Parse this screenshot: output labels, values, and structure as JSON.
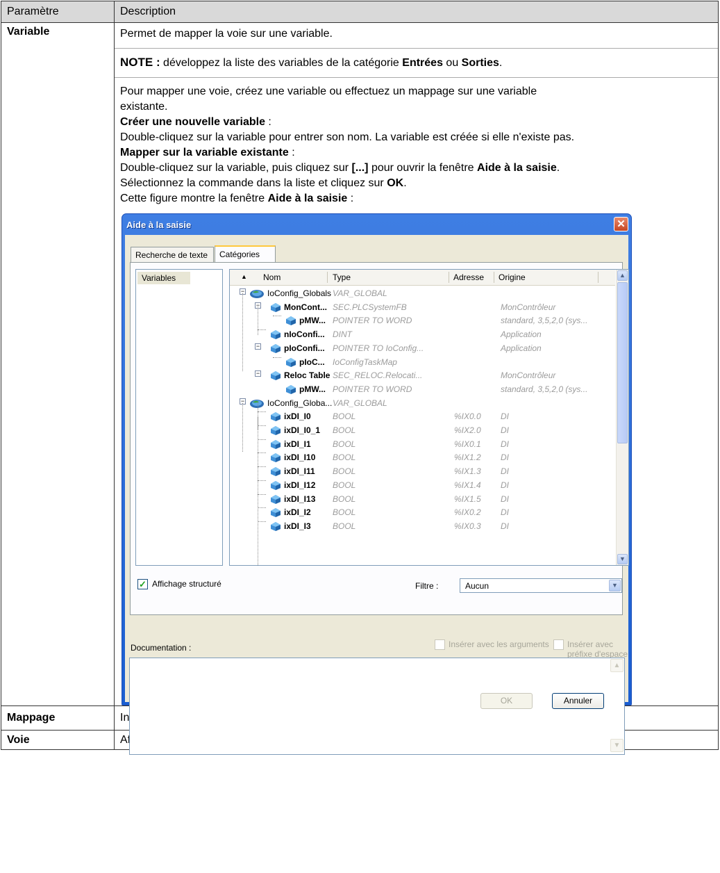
{
  "table": {
    "header": {
      "param": "Paramètre",
      "desc": "Description"
    },
    "variable": {
      "name": "Variable",
      "p1": "Permet de mapper la voie sur une variable.",
      "note_label": "NOTE :",
      "note_text_a": " développez la liste des variables de la catégorie ",
      "note_entrees": "Entrées",
      "note_or": " ou ",
      "note_sorties": "Sorties",
      "note_end": ".",
      "p3_line1": "Pour mapper une voie, créez une variable ou effectuez un mappage sur une variable",
      "p3_line2": "existante.",
      "create_title": "Créer une nouvelle variable",
      "create_colon": " :",
      "create_text": "Double-cliquez sur la variable pour entrer son nom. La variable est créée si elle n'existe pas.",
      "map_title": "Mapper sur la variable existante",
      "map_colon": " :",
      "map_text_a": "Double-cliquez sur la variable, puis cliquez sur ",
      "map_dots": "[...]",
      "map_text_b": " pour ouvrir la fenêtre ",
      "map_aide": "Aide à la saisie",
      "map_end": ".",
      "select_a": "Sélectionnez la commande dans la liste et cliquez sur ",
      "select_ok": "OK",
      "select_end": ".",
      "fig_a": "Cette figure montre la fenêtre ",
      "fig_aide": "Aide à la saisie",
      "fig_end": " :"
    },
    "mappage": {
      "name": "Mappage",
      "desc": "Indique si la voie est mappée sur une variable nouvelle ou existante."
    },
    "voie": {
      "name": "Voie",
      "desc": "Affiche le nom de la voie de l'équipement."
    }
  },
  "dialog": {
    "title": "Aide à la saisie",
    "close": "✕",
    "tabs": [
      "Recherche de texte",
      "Catégories"
    ],
    "category": "Variables",
    "columns": {
      "sort": "▲",
      "name": "Nom",
      "type": "Type",
      "address": "Adresse",
      "origin": "Origine"
    },
    "rows": [
      {
        "name": "IoConfig_Globals",
        "type": "VAR_GLOBAL",
        "address": "",
        "origin": ""
      },
      {
        "name": "MonCont...",
        "type": "SEC.PLCSystemFB",
        "address": "",
        "origin": "MonContrôleur"
      },
      {
        "name": "pMW...",
        "type": "POINTER TO WORD",
        "address": "",
        "origin": "standard, 3,5,2,0 (sys..."
      },
      {
        "name": "nIoConfi...",
        "type": "DINT",
        "address": "",
        "origin": "Application"
      },
      {
        "name": "pIoConfi...",
        "type": "POINTER TO IoConfig...",
        "address": "",
        "origin": "Application"
      },
      {
        "name": "pIoC...",
        "type": "IoConfigTaskMap",
        "address": "",
        "origin": ""
      },
      {
        "name": "Reloc Table",
        "type": "SEC_RELOC.Relocati...",
        "address": "",
        "origin": "MonContrôleur"
      },
      {
        "name": "pMW...",
        "type": "POINTER TO WORD",
        "address": "",
        "origin": "standard, 3,5,2,0 (sys..."
      },
      {
        "name": "IoConfig_Globa...",
        "type": "VAR_GLOBAL",
        "address": "",
        "origin": ""
      },
      {
        "name": "ixDI_I0",
        "type": "BOOL",
        "address": "%IX0.0",
        "origin": "DI"
      },
      {
        "name": "ixDI_I0_1",
        "type": "BOOL",
        "address": "%IX2.0",
        "origin": "DI"
      },
      {
        "name": "ixDI_I1",
        "type": "BOOL",
        "address": "%IX0.1",
        "origin": "DI"
      },
      {
        "name": "ixDI_I10",
        "type": "BOOL",
        "address": "%IX1.2",
        "origin": "DI"
      },
      {
        "name": "ixDI_I11",
        "type": "BOOL",
        "address": "%IX1.3",
        "origin": "DI"
      },
      {
        "name": "ixDI_I12",
        "type": "BOOL",
        "address": "%IX1.4",
        "origin": "DI"
      },
      {
        "name": "ixDI_I13",
        "type": "BOOL",
        "address": "%IX1.5",
        "origin": "DI"
      },
      {
        "name": "ixDI_I2",
        "type": "BOOL",
        "address": "%IX0.2",
        "origin": "DI"
      },
      {
        "name": "ixDI_I3",
        "type": "BOOL",
        "address": "%IX0.3",
        "origin": "DI"
      }
    ],
    "structured_view": {
      "label": "Affichage structuré",
      "checked": true
    },
    "filter": {
      "label": "Filtre :",
      "value": "Aucun"
    },
    "documentation_label": "Documentation :",
    "insert_args": "Insérer avec les arguments",
    "insert_ns": "Insérer avec préfixe d'espace de noms",
    "ok": "OK",
    "cancel": "Annuler"
  }
}
